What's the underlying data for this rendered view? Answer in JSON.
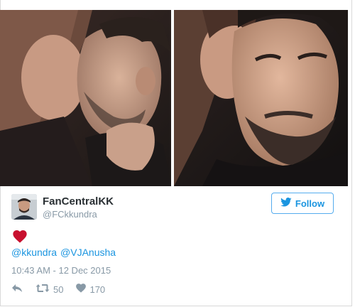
{
  "tweet": {
    "author": {
      "display_name": "FanCentralKK",
      "handle": "@FCkkundra",
      "avatar_icon": "user-avatar"
    },
    "follow_label": "Follow",
    "emoji": "heart-emoji",
    "mentions": [
      "@kkundra",
      "@VJAnusha"
    ],
    "timestamp": "10:43 AM - 12 Dec 2015",
    "retweet_count": "50",
    "like_count": "170",
    "icons": {
      "reply": "reply-icon",
      "retweet": "retweet-icon",
      "like": "heart-icon",
      "follow": "twitter-bird-icon"
    },
    "colors": {
      "link": "#1b95e0",
      "muted": "#8899a6",
      "heart": "#e0245e",
      "name": "#292f33"
    }
  }
}
